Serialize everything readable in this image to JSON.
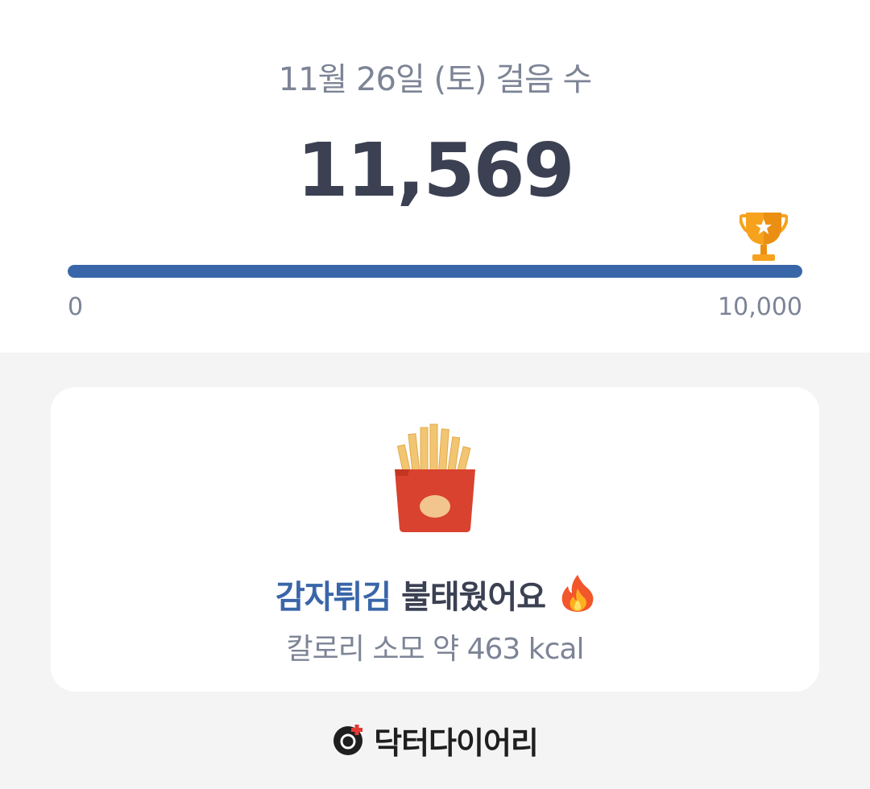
{
  "header": {
    "date_title": "11월 26일 (토) 걸음 수",
    "step_count": "11,569"
  },
  "progress": {
    "min_label": "0",
    "max_label": "10,000",
    "fraction": 1.0,
    "goal_icon": "trophy-icon"
  },
  "burn_card": {
    "food_icon": "french-fries-icon",
    "food_name": "감자튀김",
    "burn_text": " 불태웠어요",
    "fire_icon": "fire-icon",
    "calorie_text": "칼로리 소모 약 463 kcal"
  },
  "brand": {
    "logo_icon": "doctor-diary-logo-icon",
    "name": "닥터다이어리"
  },
  "colors": {
    "accent": "#3966a8",
    "text_dark": "#3b4152",
    "text_muted": "#7d8496",
    "fries_box": "#d9422e"
  }
}
